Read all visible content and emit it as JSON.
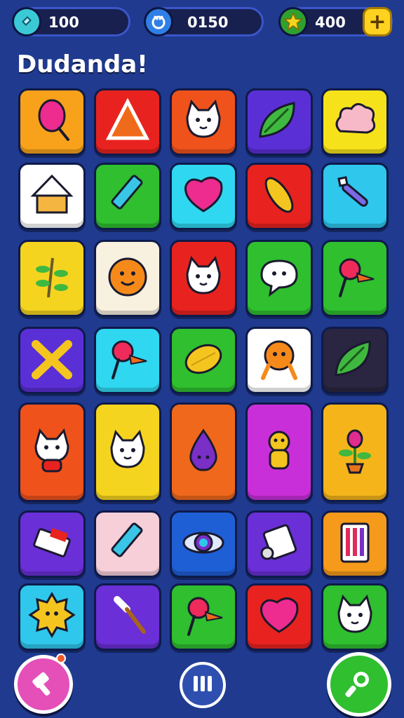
{
  "hud": {
    "gems": {
      "value": "100",
      "icon": "gem-icon",
      "color": "#3cc9d6"
    },
    "coins": {
      "value": "0150",
      "icon": "coin-icon",
      "color": "#2f7fe6"
    },
    "stars": {
      "value": "400",
      "icon": "star-icon",
      "color": "#f5d41f"
    },
    "add": {
      "label": "+",
      "icon": "plus-icon"
    }
  },
  "title": "Dudanda!",
  "tiles": [
    {
      "name": "balloon",
      "bg": "#f7a21a",
      "icon": "balloon-icon"
    },
    {
      "name": "triangle",
      "bg": "#e8231f",
      "icon": "triangle-icon"
    },
    {
      "name": "white-cat",
      "bg": "#f0521b",
      "icon": "cat-icon"
    },
    {
      "name": "leaf",
      "bg": "#5b2fd6",
      "icon": "leaf-icon"
    },
    {
      "name": "cloud",
      "bg": "#f5e21a",
      "icon": "cloud-icon"
    },
    {
      "name": "house",
      "bg": "#ffffff",
      "icon": "house-icon"
    },
    {
      "name": "pencil",
      "bg": "#2fbf2f",
      "icon": "pencil-icon"
    },
    {
      "name": "heart-bubble",
      "bg": "#2fd7f0",
      "icon": "heart-icon"
    },
    {
      "name": "seed",
      "bg": "#e8231f",
      "icon": "seed-icon"
    },
    {
      "name": "bone",
      "bg": "#2fc7ec",
      "icon": "bone-icon"
    },
    {
      "name": "branch",
      "bg": "#f5d41f",
      "icon": "branch-icon"
    },
    {
      "name": "orange-face",
      "bg": "#f8f1e0",
      "icon": "face-icon"
    },
    {
      "name": "purple-cat",
      "bg": "#e8231f",
      "icon": "cat-icon"
    },
    {
      "name": "speech-bubble",
      "bg": "#2fbf2f",
      "icon": "speech-bubble-icon"
    },
    {
      "name": "flower-pin",
      "bg": "#2fbf2f",
      "icon": "pin-icon"
    },
    {
      "name": "cross",
      "bg": "#5b2fd6",
      "icon": "cross-icon"
    },
    {
      "name": "red-pin",
      "bg": "#2fd7f0",
      "icon": "pin-icon"
    },
    {
      "name": "lemon",
      "bg": "#2fbf2f",
      "icon": "lemon-icon"
    },
    {
      "name": "orange-creature",
      "bg": "#ffffff",
      "icon": "creature-icon"
    },
    {
      "name": "red-leaf",
      "bg": "#2a2540",
      "icon": "leaf-icon"
    },
    {
      "name": "fox",
      "bg": "#f0521b",
      "icon": "fox-icon"
    },
    {
      "name": "pink-cat",
      "bg": "#f5d41f",
      "icon": "cat-icon"
    },
    {
      "name": "drop",
      "bg": "#f0681b",
      "icon": "drop-icon"
    },
    {
      "name": "yellow-bear",
      "bg": "#c92fd9",
      "icon": "bear-icon"
    },
    {
      "name": "potted-flower",
      "bg": "#f5b51a",
      "icon": "flower-icon"
    },
    {
      "name": "eraser",
      "bg": "#6a2fd6",
      "icon": "eraser-icon"
    },
    {
      "name": "green-pencil",
      "bg": "#f7cfd9",
      "icon": "pencil-icon"
    },
    {
      "name": "ring",
      "bg": "#1f5fd6",
      "icon": "ring-icon"
    },
    {
      "name": "scroll",
      "bg": "#6a2fd6",
      "icon": "scroll-icon"
    },
    {
      "name": "calculator",
      "bg": "#f59a1a",
      "icon": "calculator-icon"
    },
    {
      "name": "sun",
      "bg": "#2fc7ec",
      "icon": "sun-icon"
    },
    {
      "name": "brush",
      "bg": "#6a2fd6",
      "icon": "brush-icon"
    },
    {
      "name": "yellow-pin",
      "bg": "#2fbf2f",
      "icon": "pin-icon"
    },
    {
      "name": "purple-heart",
      "bg": "#e8231f",
      "icon": "heart-icon"
    },
    {
      "name": "blue-cat",
      "bg": "#2fbf2f",
      "icon": "cat-icon"
    }
  ],
  "bottom": {
    "left": {
      "icon": "hammer-icon",
      "color": "#e54fb8"
    },
    "center": {
      "icon": "pause-icon",
      "color": "#2f4fb0"
    },
    "right": {
      "icon": "magnifier-icon",
      "color": "#2fbf2f"
    }
  }
}
